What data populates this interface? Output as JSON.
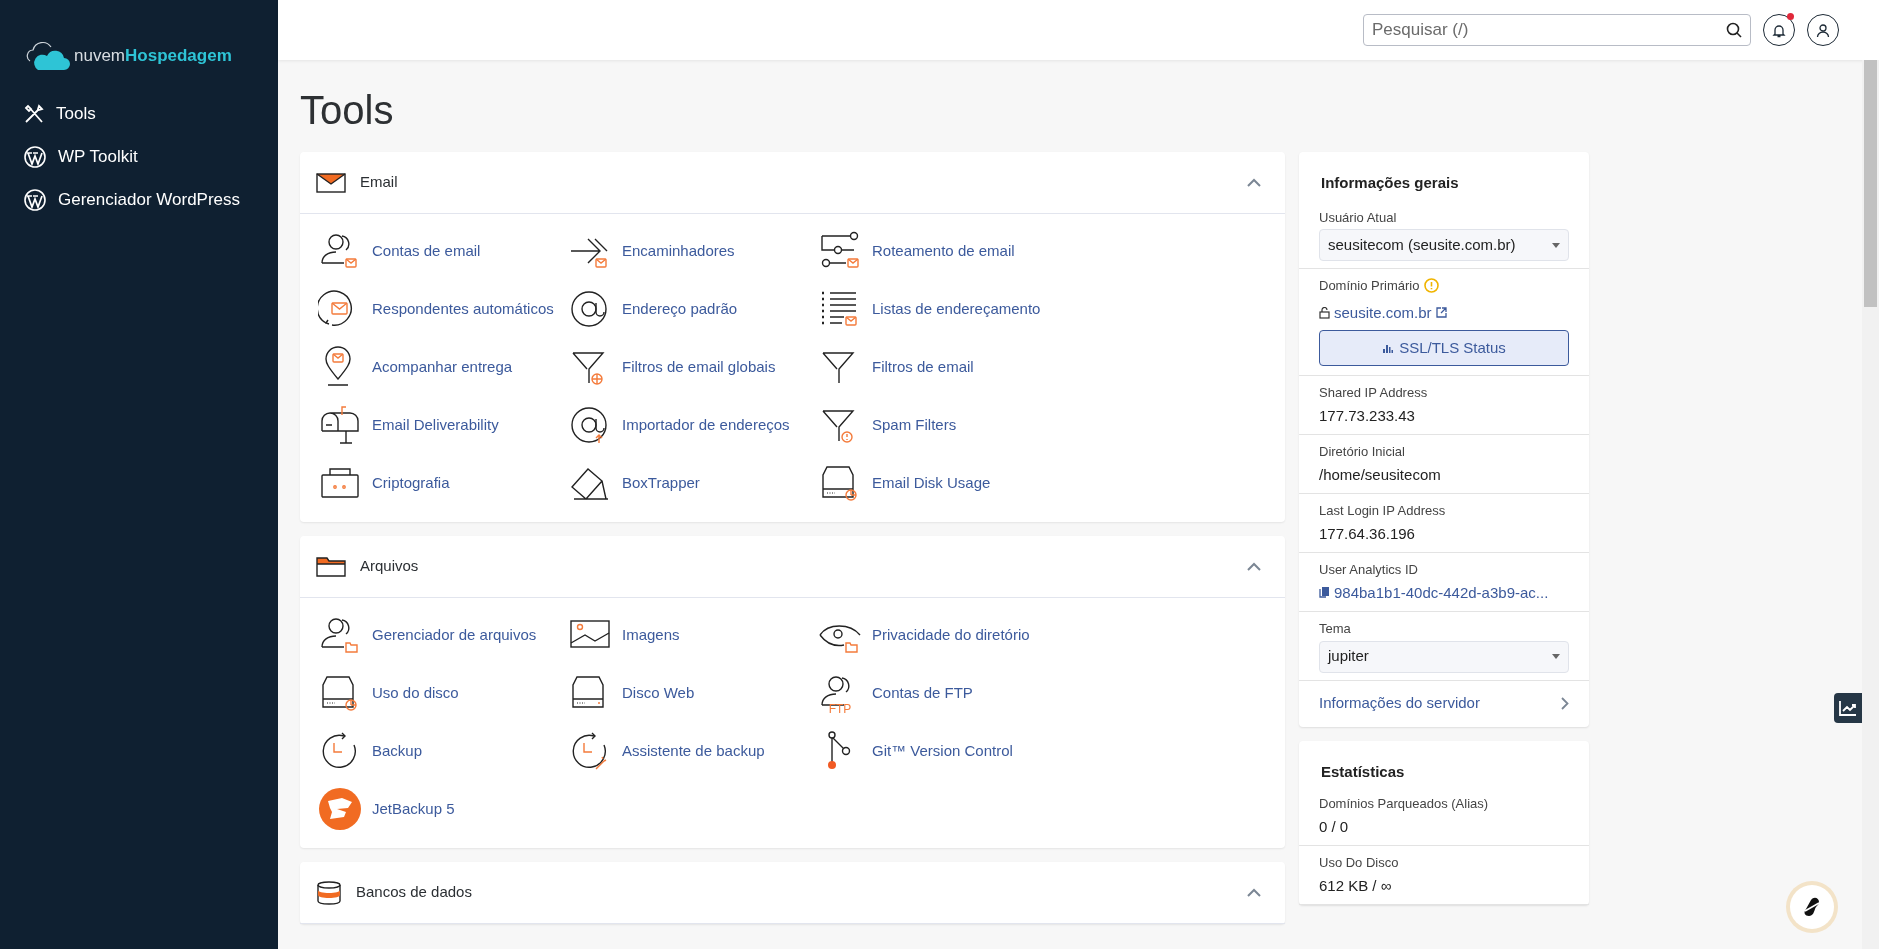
{
  "brand": {
    "prefix": "nuvem",
    "name": "Hospedagem"
  },
  "sidebar": {
    "items": [
      {
        "label": "Tools",
        "kind": "tools"
      },
      {
        "label": "WP Toolkit",
        "kind": "wordpress"
      },
      {
        "label": "Gerenciador WordPress",
        "kind": "wordpress"
      }
    ]
  },
  "search": {
    "placeholder": "Pesquisar (/)"
  },
  "notifications": {
    "unread": true
  },
  "page_title": "Tools",
  "sections": [
    {
      "title": "Email",
      "kind": "email",
      "expanded": true,
      "items": [
        {
          "label": "Contas de email"
        },
        {
          "label": "Encaminhadores"
        },
        {
          "label": "Roteamento de email"
        },
        {
          "label": "Respondentes automáticos"
        },
        {
          "label": "Endereço padrão"
        },
        {
          "label": "Listas de endereçamento"
        },
        {
          "label": "Acompanhar entrega"
        },
        {
          "label": "Filtros de email globais"
        },
        {
          "label": "Filtros de email"
        },
        {
          "label": "Email Deliverability"
        },
        {
          "label": "Importador de endereços"
        },
        {
          "label": "Spam Filters"
        },
        {
          "label": "Criptografia"
        },
        {
          "label": "BoxTrapper"
        },
        {
          "label": "Email Disk Usage"
        }
      ]
    },
    {
      "title": "Arquivos",
      "kind": "files",
      "expanded": true,
      "items": [
        {
          "label": "Gerenciador de arquivos"
        },
        {
          "label": "Imagens"
        },
        {
          "label": "Privacidade do diretório"
        },
        {
          "label": "Uso do disco"
        },
        {
          "label": "Disco Web"
        },
        {
          "label": "Contas de FTP",
          "icon_text": "FTP"
        },
        {
          "label": "Backup"
        },
        {
          "label": "Assistente de backup"
        },
        {
          "label": "Git™ Version Control"
        },
        {
          "label": "JetBackup 5"
        }
      ]
    },
    {
      "title": "Bancos de dados",
      "kind": "databases",
      "expanded": true
    }
  ],
  "general_info": {
    "title": "Informações gerais",
    "current_user": {
      "label": "Usuário Atual",
      "value": "seusitecom (seusite.com.br)"
    },
    "primary_domain": {
      "label": "Domínio Primário",
      "warning": true,
      "domain": "seusite.com.br",
      "button": "SSL/TLS Status"
    },
    "fields": [
      {
        "label": "Shared IP Address",
        "value": "177.73.233.43",
        "kind": "text"
      },
      {
        "label": "Diretório Inicial",
        "value": "/home/seusitecom",
        "kind": "text"
      },
      {
        "label": "Last Login IP Address",
        "value": "177.64.36.196",
        "kind": "text"
      },
      {
        "label": "User Analytics ID",
        "value": "984ba1b1-40dc-442d-a3b9-ac...",
        "kind": "copy"
      }
    ],
    "theme": {
      "label": "Tema",
      "value": "jupiter"
    },
    "server_info_link": "Informações do servidor"
  },
  "statistics": {
    "title": "Estatísticas",
    "fields": [
      {
        "label": "Domínios Parqueados (Alias)",
        "value": "0 / 0"
      },
      {
        "label": "Uso Do Disco",
        "value": "612 KB / ∞"
      }
    ]
  }
}
